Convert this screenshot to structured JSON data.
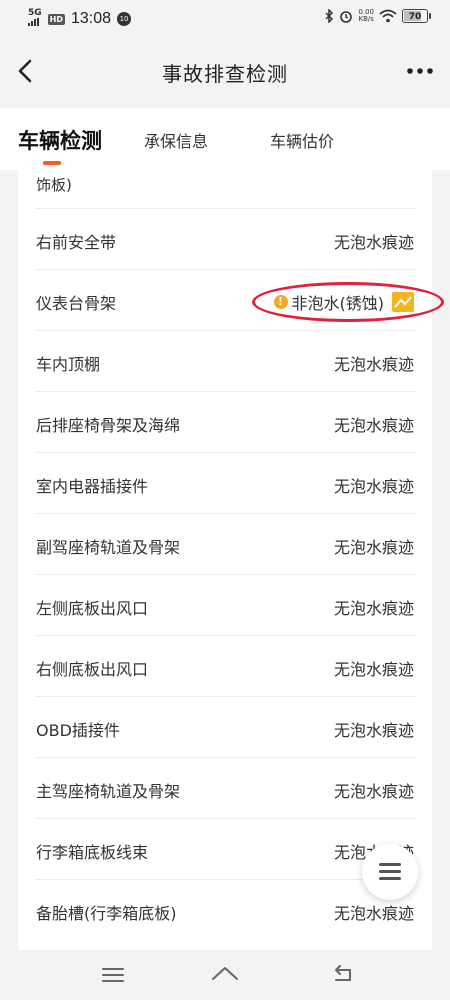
{
  "status_bar": {
    "network": "5G",
    "hd": "HD",
    "time": "13:08",
    "notif_badge": "10",
    "net_speed_value": "0.00",
    "net_speed_unit": "KB/s",
    "battery": "70"
  },
  "header": {
    "title": "事故排查检测"
  },
  "tabs": [
    {
      "label": "车辆检测",
      "active": true
    },
    {
      "label": "承保信息",
      "active": false
    },
    {
      "label": "车辆估价",
      "active": false
    }
  ],
  "partial_row": {
    "label": "饰板)"
  },
  "rows": [
    {
      "label": "右前安全带",
      "value": "无泡水痕迹"
    },
    {
      "label": "仪表台骨架",
      "value": "非泡水(锈蚀)",
      "flagged": true
    },
    {
      "label": "车内顶棚",
      "value": "无泡水痕迹"
    },
    {
      "label": "后排座椅骨架及海绵",
      "value": "无泡水痕迹"
    },
    {
      "label": "室内电器插接件",
      "value": "无泡水痕迹"
    },
    {
      "label": "副驾座椅轨道及骨架",
      "value": "无泡水痕迹"
    },
    {
      "label": "左侧底板出风口",
      "value": "无泡水痕迹"
    },
    {
      "label": "右侧底板出风口",
      "value": "无泡水痕迹"
    },
    {
      "label": "OBD插接件",
      "value": "无泡水痕迹"
    },
    {
      "label": "主驾座椅轨道及骨架",
      "value": "无泡水痕迹"
    },
    {
      "label": "行李箱底板线束",
      "value": "无泡水痕迹"
    },
    {
      "label": "备胎槽(行李箱底板)",
      "value": "无泡水痕迹"
    }
  ],
  "colors": {
    "accent": "#ff5a1f",
    "warn": "#f5a623",
    "highlight_circle": "#e1203a"
  }
}
